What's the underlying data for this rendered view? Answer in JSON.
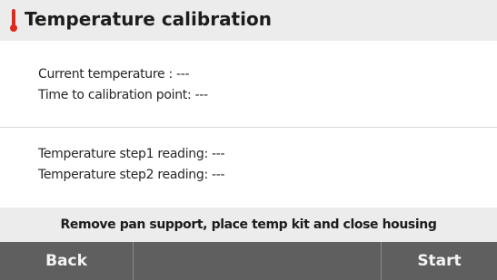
{
  "header": {
    "icon": "thermometer-icon",
    "title": "Temperature calibration"
  },
  "calibration_info": {
    "current_temperature": "Current temperature : ---",
    "time_to_calibration_point": "Time to calibration point: ---"
  },
  "step_readings": {
    "step1": "Temperature step1 reading: ---",
    "step2": "Temperature step2 reading: ---"
  },
  "instruction": "Remove pan support, place temp kit and close housing",
  "footer": {
    "back_label": "Back",
    "middle_label": "",
    "start_label": "Start"
  },
  "colors": {
    "thermometer": "#e0281c",
    "button_bar": "#5f5f5f",
    "header_bg": "#ececec"
  }
}
